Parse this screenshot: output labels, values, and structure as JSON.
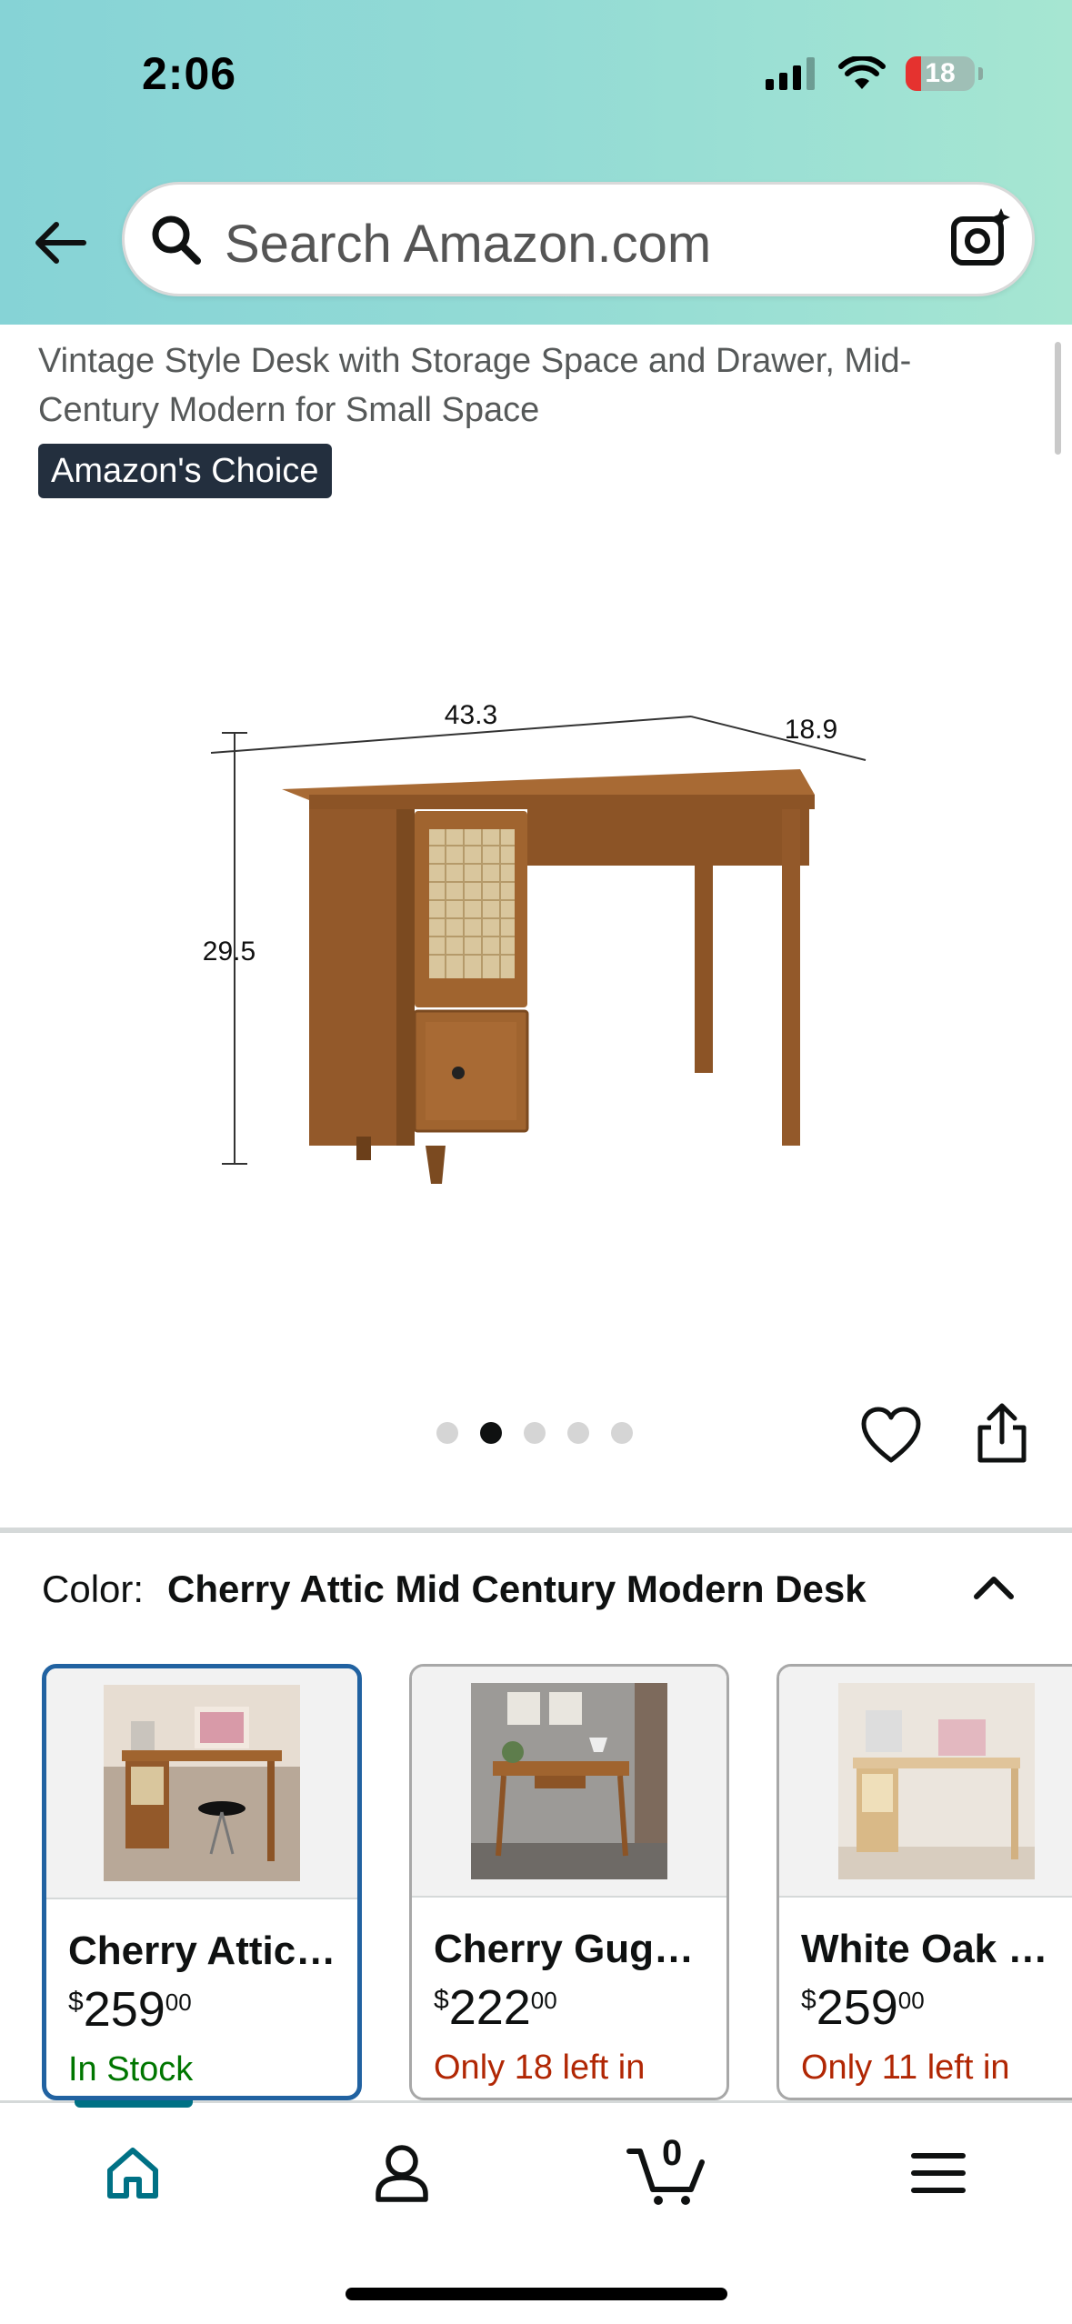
{
  "status_bar": {
    "time": "2:06",
    "battery": "18"
  },
  "search": {
    "placeholder": "Search Amazon.com"
  },
  "product": {
    "title": "Vintage Style Desk with Storage Space and Drawer, Mid-Century Modern for Small Space",
    "badge": "Amazon's Choice",
    "dimensions": {
      "width": "43.3",
      "depth": "18.9",
      "height": "29.5"
    },
    "image_count": 5,
    "active_image": 2
  },
  "color": {
    "label": "Color:",
    "value": "Cherry Attic Mid Century Modern Desk"
  },
  "variants": [
    {
      "name": "Cherry Attic…",
      "currency": "$",
      "price": "259",
      "cents": "00",
      "stock": "In Stock",
      "stock_status": "in",
      "selected": true
    },
    {
      "name": "Cherry Gug…",
      "currency": "$",
      "price": "222",
      "cents": "00",
      "stock": "Only 18 left in",
      "stock_status": "low",
      "selected": false
    },
    {
      "name": "White Oak …",
      "currency": "$",
      "price": "259",
      "cents": "00",
      "stock": "Only 11 left in",
      "stock_status": "low",
      "selected": false
    }
  ],
  "nav": {
    "cart_count": "0",
    "items": [
      "home-icon",
      "account-icon",
      "cart-icon",
      "menu-icon"
    ]
  },
  "colors": {
    "accent_teal": "#007185",
    "selected_border": "#2162a1",
    "in_stock": "#007600",
    "low_stock": "#b12704"
  }
}
